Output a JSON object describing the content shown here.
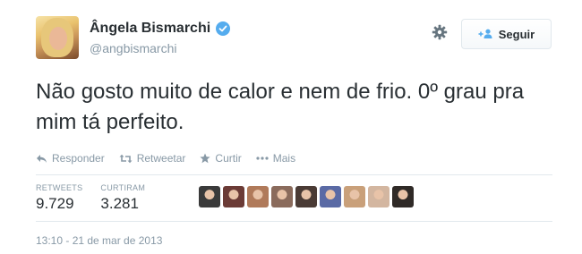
{
  "user": {
    "name": "Ângela Bismarchi",
    "handle": "@angbismarchi",
    "verified": true
  },
  "header": {
    "follow_label": "Seguir"
  },
  "tweet": {
    "text": "Não gosto muito de calor e nem de frio. 0º grau pra mim tá perfeito."
  },
  "actions": [
    {
      "icon": "reply-icon",
      "label": "Responder"
    },
    {
      "icon": "retweet-icon",
      "label": "Retweetar"
    },
    {
      "icon": "star-icon",
      "label": "Curtir"
    },
    {
      "icon": "more-icon",
      "label": "Mais"
    }
  ],
  "stats": {
    "retweets_label": "RETWEETS",
    "retweets_value": "9.729",
    "likes_label": "CURTIRAM",
    "likes_value": "3.281"
  },
  "likers_colors": [
    "#3a3a3a",
    "#6b3b36",
    "#b07a5a",
    "#8a6b5c",
    "#4a3b35",
    "#5a6aa5",
    "#c9a07a",
    "#d3b6a0",
    "#2f2a27"
  ],
  "timestamp": "13:10 - 21 de mar de 2013",
  "colors": {
    "verified_blue": "#55acee",
    "follow_blue": "#55acee",
    "text": "#292f33",
    "muted": "#8899a6"
  }
}
